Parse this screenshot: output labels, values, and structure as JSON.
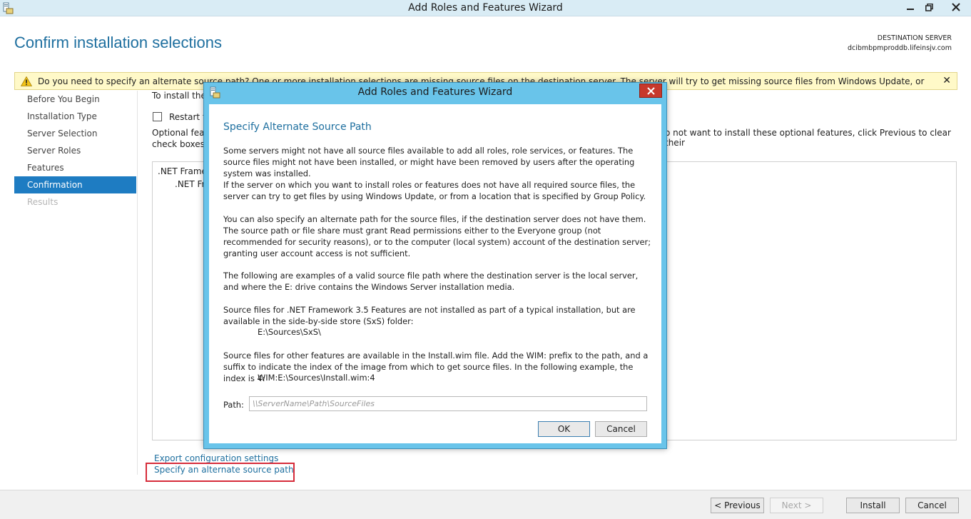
{
  "window": {
    "title": "Add Roles and Features Wizard"
  },
  "page": {
    "title": "Confirm installation selections",
    "destination_label": "DESTINATION SERVER",
    "destination_name": "dcibmbpmproddb.lifeinsjv.com"
  },
  "warning": {
    "text": "Do you need to specify an alternate source path? One or more installation selections are missing source files on the destination server. The server will try to get missing source files from Windows Update, or from a location that is specif..."
  },
  "nav": {
    "items": [
      {
        "label": "Before You Begin"
      },
      {
        "label": "Installation Type"
      },
      {
        "label": "Server Selection"
      },
      {
        "label": "Server Roles"
      },
      {
        "label": "Features"
      },
      {
        "label": "Confirmation"
      },
      {
        "label": "Results"
      }
    ]
  },
  "content": {
    "install_text": "To install the",
    "restart_label": "Restart th",
    "optional_left": "Optional featu",
    "optional_right": "o not want to install these optional features, click Previous to clear their",
    "check_boxes": "check boxes.",
    "list_items": [
      ".NET Framew",
      ".NET Fra"
    ],
    "export_link": "Export configuration settings",
    "alternate_link": "Specify an alternate source path"
  },
  "buttons": {
    "previous": "< Previous",
    "next": "Next >",
    "install": "Install",
    "cancel": "Cancel"
  },
  "modal": {
    "title": "Add Roles and Features Wizard",
    "heading": "Specify Alternate Source Path",
    "p1": "Some servers might not have all source files available to add all roles, role services, or features. The source files might not have been installed, or might have been removed by users after the operating system was installed.",
    "p2": "If the server on which you want to install roles or features does not have all required source files, the server can try to get files by using Windows Update, or from a location that is specified by Group Policy.",
    "p3": "You can also specify an alternate path for the source files, if the destination server does not have them. The source path or file share must grant Read permissions either to the Everyone group (not recommended for security reasons), or to the computer (local system) account of the destination server; granting user account access is not sufficient.",
    "p4": "The following are examples of a valid source file path where the destination server is the local server, and where the E: drive contains the Windows Server installation media.",
    "p5": "Source files for .NET Framework 3.5 Features are not installed as part of a typical installation, but are available in the side-by-side store (SxS) folder:",
    "path1": "E:\\Sources\\SxS\\",
    "p6": "Source files for other features are available in the Install.wim file. Add the WIM: prefix to the path, and a suffix to indicate the index of the image from which to get source files. In the following example, the index is 4:",
    "path2": "WIM:E:\\Sources\\Install.wim:4",
    "path_label": "Path:",
    "path_placeholder": "\\\\ServerName\\Path\\SourceFiles",
    "path_value": "",
    "ok": "OK",
    "cancel": "Cancel"
  },
  "colors": {
    "accent": "#1e7cc2",
    "heading": "#1e6f9f",
    "modal_frame": "#69c4ea",
    "warning_bg": "#fff9c8",
    "close_red": "#c7392c",
    "highlight": "#d62c3a"
  }
}
